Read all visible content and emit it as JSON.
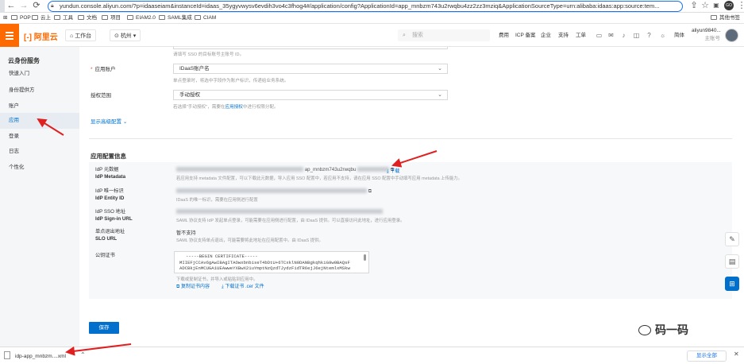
{
  "browser": {
    "url": "yundun.console.aliyun.com/?p=idaaseiam&instanceId=idaas_35ygyvwysv6evdih3vo4c3fhog4#/application/config?ApplicationId=app_mnbzm743u2rwqbu4zz2zz3mziq&ApplicationSourceType=urn:alibaba:idaas:app:source:tem...",
    "profile": "GO",
    "bookmarks": [
      "POP",
      "云上",
      "工具",
      "文档",
      "项目",
      "EIAM2.0",
      "SAML集成",
      "CIAM"
    ],
    "other_bookmarks": "其他书签"
  },
  "topbar": {
    "logo": "阿里云",
    "workbench": "工作台",
    "region": "杭州",
    "search_placeholder": "搜索",
    "links": [
      "费用",
      "ICP 备案",
      "企业",
      "支持",
      "工单"
    ],
    "lang": "简体",
    "account_name": "aliyun9840...",
    "account_role": "主账号"
  },
  "sidebar": {
    "title": "云身份服务",
    "items": [
      {
        "label": "快速入门"
      },
      {
        "label": "身份提供方"
      },
      {
        "label": "账户"
      },
      {
        "label": "应用"
      },
      {
        "label": "登录"
      },
      {
        "label": "日志"
      },
      {
        "label": "个性化"
      }
    ]
  },
  "form": {
    "top_hint": "请填写 SSO 的目标账号主账号 ID。",
    "account_label": "应用账户",
    "account_value": "IDaaS账户名",
    "account_hint": "单点登录时，将选中字段作为账户标识，传递给业务系统。",
    "scope_label": "授权范围",
    "scope_value": "手动授权",
    "scope_hint_pre": "若选择\"手动授权\"，需要在",
    "scope_hint_link": "应用授权",
    "scope_hint_post": "中进行权限分配。",
    "advanced": "显示高级配置"
  },
  "config": {
    "title": "应用配置信息",
    "metadata_cn": "IdP 元数据",
    "metadata_en": "IdP Metadata",
    "metadata_value": "ap_mnbzm743u2rwqbu",
    "metadata_download": "下载",
    "metadata_hint": "若应用支持 metadata 文件配置，可以下载此元数据，导入应用 SSO 配置中，若应用不支持，请在应用 SSO 配置中手动填写应用 metadata 上传能力。",
    "entity_cn": "IdP 唯一标识",
    "entity_en": "IdP Entity ID",
    "entity_hint": "IDaaS 的唯一标识，需要在应用侧进行配置",
    "sso_cn": "IdP SSO 地址",
    "sso_en": "IdP Sign-in URL",
    "sso_hint": "SAML 协议支持 IdP 发起单点登录，可能需要在应用侧进行配置，由 IDaaS 提供。可以直接访问此地址，进行应用登录。",
    "slo_cn": "单点退出地址",
    "slo_en": "SLO URL",
    "slo_value": "暂不支持",
    "slo_hint": "SAML 协议支持单点退出，可能需要将此地址在应用配置中。由 IDaaS 提供。",
    "cert_label": "公钥证书",
    "cert_lines": [
      "-----BEGIN CERTIFICATE-----",
      "MIIEFjCCAv6gAwIBAgITAOwxbnbiseT4bDtU+6TCxklN0DANBgkqhkiG9w0BAQsF",
      "ADCBkjEnMCUGA1UEAwweYXBwX21uYmptNzQzdTJydzFidTR6ejJ6ejNtemlxMSkw"
    ],
    "cert_hint": "下载或复制证书，并导入或粘贴到应用中。",
    "copy_cert": "复制证书内容",
    "download_cert": "下载证书 .cer 文件"
  },
  "save": "保存",
  "watermark": "码一码",
  "download_bar": {
    "file": "idp-app_mnbzm....xml",
    "show_all": "显示全部"
  }
}
